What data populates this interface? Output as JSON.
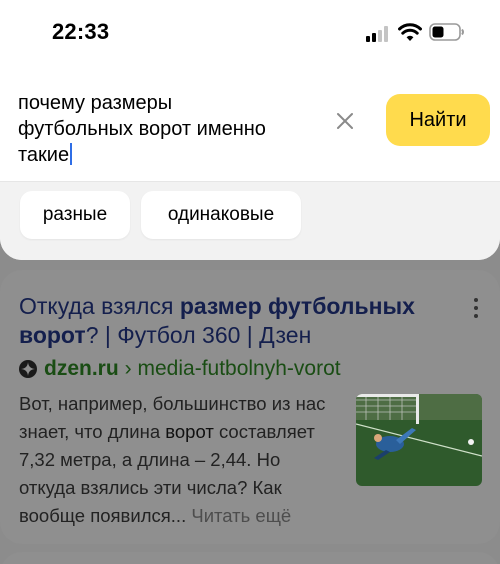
{
  "status_bar": {
    "time": "22:33"
  },
  "search": {
    "query_line1": "почему размеры",
    "query_line2": "футбольных ворот именно",
    "query_line3": "такие",
    "button_label": "Найти"
  },
  "suggestions": [
    "разные",
    "одинаковые"
  ],
  "result": {
    "title_plain": "Откуда взялся ",
    "title_bold": "размер футбольных ворот",
    "title_rest": "? | Футбол 360 | Дзен",
    "domain": "dzen.ru",
    "path": "› media-futbolnyh-vorot",
    "snippet_a": "Вот, например, большинство из нас знает, что длина ",
    "snippet_bold": "ворот",
    "snippet_b": " составляет 7,32 метра, а длина – 2,44. Но откуда взялись эти числа? Как вообще появился... ",
    "more_label": "Читать ещё"
  },
  "colors": {
    "accent": "#ffdb4d",
    "caret": "#2f6ee6",
    "link": "#141f4d",
    "url": "#1a4d14"
  }
}
